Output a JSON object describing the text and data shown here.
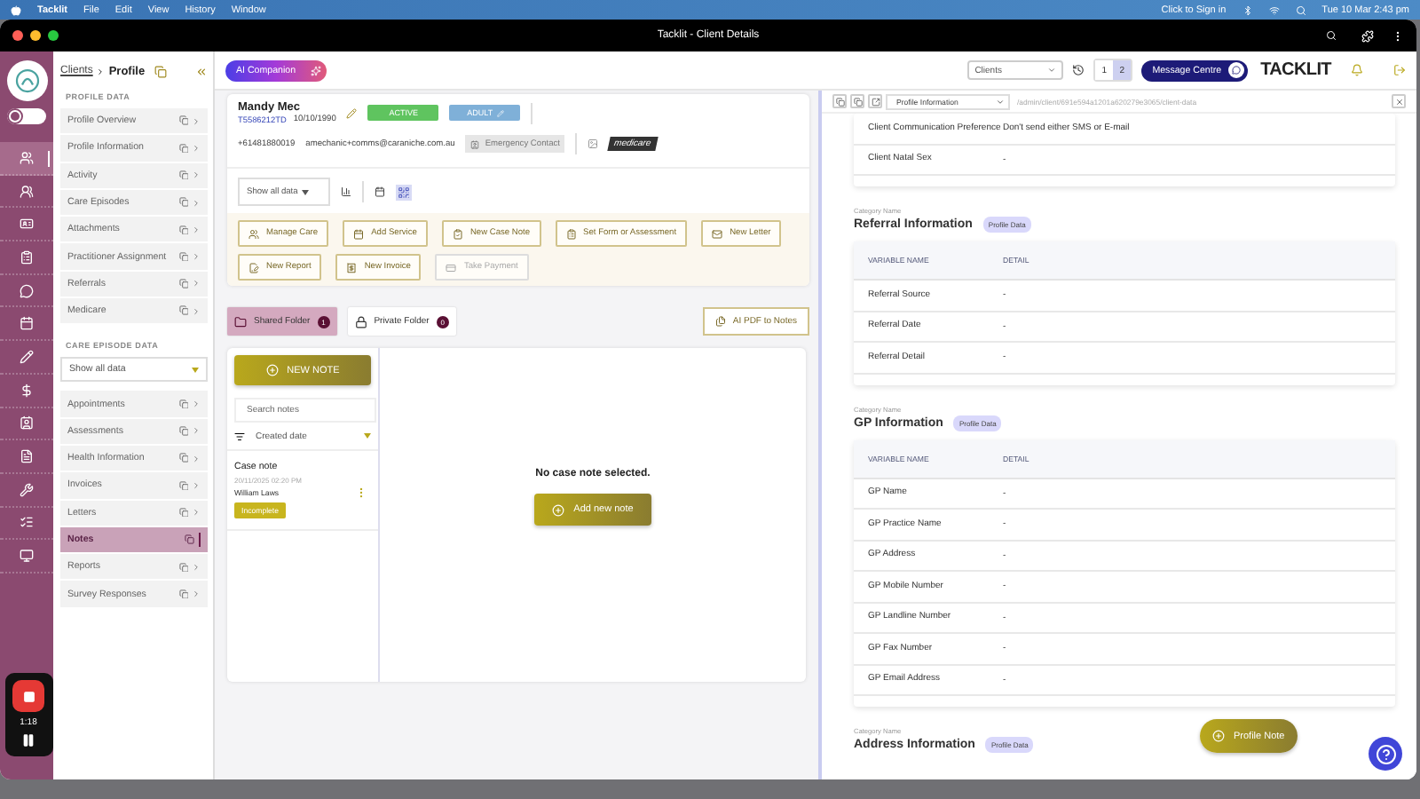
{
  "menubar": {
    "app": "Tacklit",
    "menus": [
      "File",
      "Edit",
      "View",
      "History",
      "Window"
    ],
    "sign_in": "Click to Sign in",
    "clock": "Tue 10 Mar  2:43 pm"
  },
  "window": {
    "title": "Tacklit - Client Details"
  },
  "rail": [
    {
      "selected": true
    },
    {
      "selected": false
    },
    {
      "selected": false
    },
    {
      "selected": false
    },
    {
      "selected": false
    },
    {
      "selected": false
    },
    {
      "selected": false
    },
    {
      "selected": false
    },
    {
      "selected": false
    },
    {
      "selected": false
    },
    {
      "selected": false
    },
    {
      "selected": false
    },
    {
      "selected": false
    }
  ],
  "rail_toggle": {
    "on": false
  },
  "recorder": {
    "time": "1:18"
  },
  "breadcrumb": {
    "parent": "Clients",
    "current": "Profile"
  },
  "profile_data": {
    "heading": "PROFILE DATA",
    "items": [
      {
        "label": "Profile Overview",
        "selected": false
      },
      {
        "label": "Profile Information",
        "selected": false
      },
      {
        "label": "Activity",
        "selected": false
      },
      {
        "label": "Care Episodes",
        "selected": false
      },
      {
        "label": "Attachments",
        "selected": false
      },
      {
        "label": "Practitioner Assignment",
        "selected": false
      },
      {
        "label": "Referrals",
        "selected": false
      },
      {
        "label": "Medicare",
        "selected": false
      }
    ]
  },
  "care_episode": {
    "heading": "CARE EPISODE DATA",
    "filter": "Show all data",
    "items": [
      {
        "label": "Appointments",
        "selected": false
      },
      {
        "label": "Assessments",
        "selected": false
      },
      {
        "label": "Health Information",
        "selected": false
      },
      {
        "label": "Invoices",
        "selected": false
      },
      {
        "label": "Letters",
        "selected": false
      },
      {
        "label": "Notes",
        "selected": true
      },
      {
        "label": "Reports",
        "selected": false
      },
      {
        "label": "Survey Responses",
        "selected": false
      }
    ]
  },
  "header": {
    "ai_button": "AI Companion",
    "clients_select": "Clients",
    "pages": [
      {
        "label": "1",
        "selected": false
      },
      {
        "label": "2",
        "selected": true
      }
    ],
    "message_centre": "Message Centre",
    "brand": "TACKLIT"
  },
  "client": {
    "name": "Mandy Mec",
    "id": "T5586212TD",
    "dob": "10/10/1990",
    "status": "ACTIVE",
    "age_group": "ADULT",
    "phone": "+61481880019",
    "email": "amechanic+comms@caraniche.com.au",
    "emergency": "Emergency Contact",
    "medicare": "medicare"
  },
  "filter": "Show all data",
  "actions": [
    {
      "label": "Manage Care",
      "disabled": false
    },
    {
      "label": "Add Service",
      "disabled": false
    },
    {
      "label": "New Case Note",
      "disabled": false
    },
    {
      "label": "Set Form or Assessment",
      "disabled": false
    },
    {
      "label": "New Letter",
      "disabled": false
    },
    {
      "label": "New Report",
      "disabled": false
    },
    {
      "label": "New Invoice",
      "disabled": false
    },
    {
      "label": "Take Payment",
      "disabled": true
    }
  ],
  "folders": [
    {
      "label": "Shared Folder",
      "count": "1",
      "selected": true
    },
    {
      "label": "Private Folder",
      "count": "0",
      "selected": false
    }
  ],
  "ai_pdf": "AI PDF to Notes",
  "notes": {
    "new_note": "NEW NOTE",
    "search_placeholder": "Search notes",
    "sort": "Created date",
    "items": [
      {
        "title": "Case note",
        "date": "20/11/2025 02:20 PM",
        "author": "William Laws",
        "status": "Incomplete"
      }
    ],
    "empty": "No case note selected.",
    "add": "Add new note"
  },
  "panel": {
    "select": "Profile Information",
    "url": "/admin/client/691e594a1201a620279e3065/client-data",
    "top_rows": [
      {
        "name": "Client Communication Preference",
        "detail": "Don't send either SMS or E-mail"
      },
      {
        "name": "Client Natal Sex",
        "detail": "-"
      }
    ],
    "sections": [
      {
        "category": "Category Name",
        "title": "Referral Information",
        "tag": "Profile Data",
        "columns": [
          "VARIABLE NAME",
          "DETAIL"
        ],
        "rows": [
          {
            "name": "Referral Source",
            "detail": "-"
          },
          {
            "name": "Referral Date",
            "detail": "-"
          },
          {
            "name": "Referral Detail",
            "detail": "-"
          }
        ]
      },
      {
        "category": "Category Name",
        "title": "GP Information",
        "tag": "Profile Data",
        "columns": [
          "VARIABLE NAME",
          "DETAIL"
        ],
        "rows": [
          {
            "name": "GP Name",
            "detail": "-"
          },
          {
            "name": "GP Practice Name",
            "detail": "-"
          },
          {
            "name": "GP Address",
            "detail": "-"
          },
          {
            "name": "GP Mobile Number",
            "detail": "-"
          },
          {
            "name": "GP Landline Number",
            "detail": "-"
          },
          {
            "name": "GP Fax Number",
            "detail": "-"
          },
          {
            "name": "GP Email Address",
            "detail": "-"
          }
        ]
      },
      {
        "category": "Category Name",
        "title": "Address Information",
        "tag": "Profile Data"
      }
    ]
  },
  "profile_note": "Profile Note"
}
